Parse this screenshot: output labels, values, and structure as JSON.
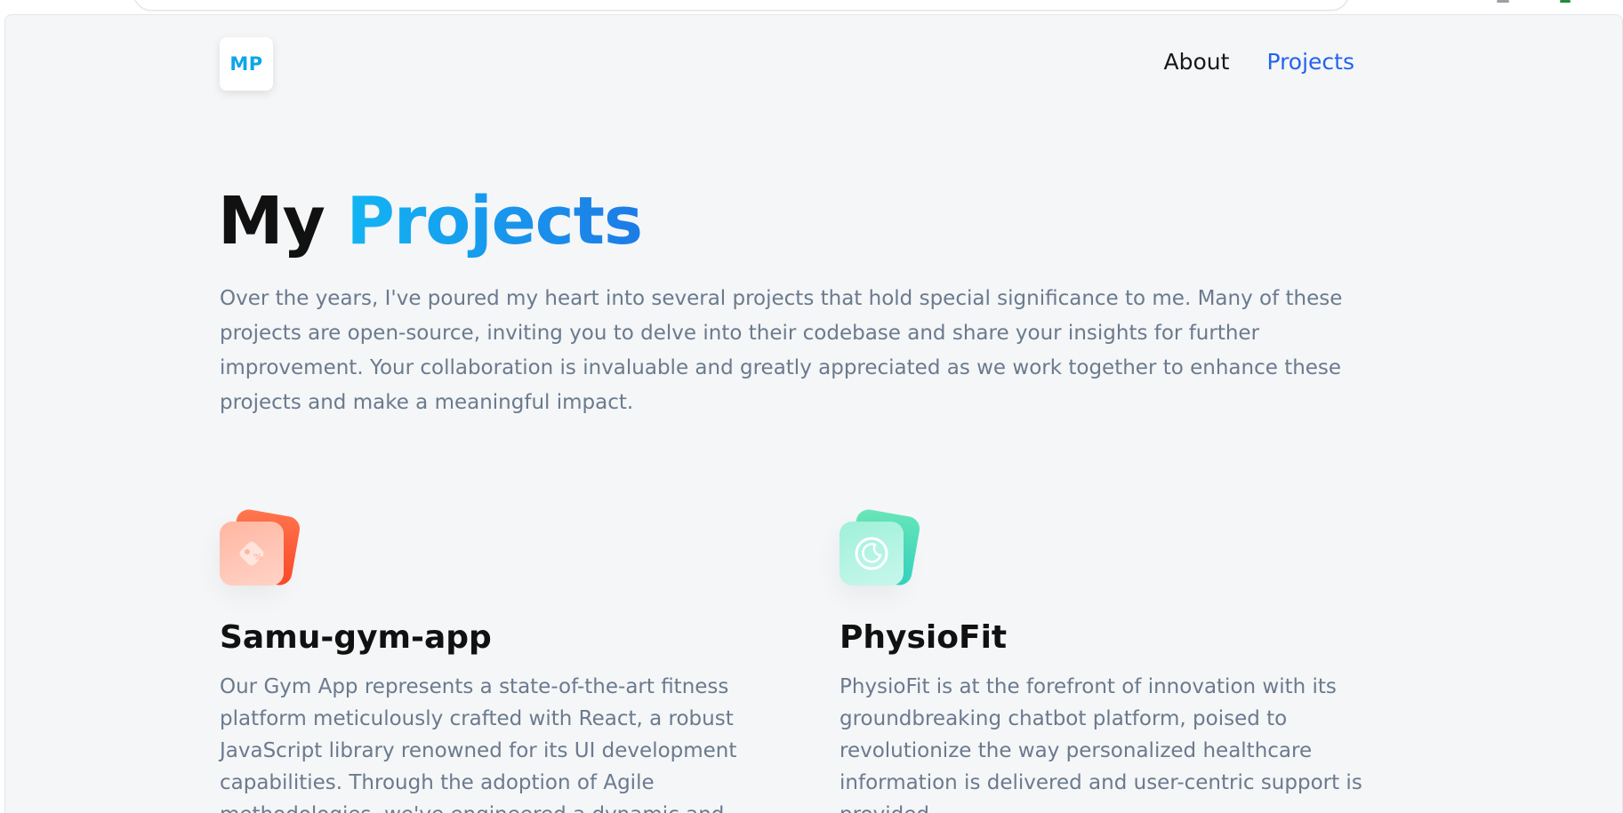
{
  "nav": {
    "logo_text": "MP",
    "links": [
      {
        "label": "About",
        "active": false
      },
      {
        "label": "Projects",
        "active": true
      }
    ],
    "active_color": "#2563eb"
  },
  "hero": {
    "title_plain": "My",
    "title_accent": "Projects",
    "description": "Over the years, I've poured my heart into several projects that hold special significance to me. Many of these projects are open-source, inviting you to delve into their codebase and share your insights for further improvement. Your collaboration is invaluable and greatly appreciated as we work together to enhance these projects and make a meaningful impact."
  },
  "projects": [
    {
      "icon": "tag-icon",
      "title": "Samu-gym-app",
      "description": "Our Gym App represents a state-of-the-art fitness platform meticulously crafted with React, a robust JavaScript library renowned for its UI development capabilities. Through the adoption of Agile methodologies, we've engineered a dynamic and"
    },
    {
      "icon": "moon-clock-icon",
      "title": "PhysioFit",
      "description": "PhysioFit is at the forefront of innovation with its groundbreaking chatbot platform, poised to revolutionize the way personalized healthcare information is delivered and user-centric support is provided."
    }
  ]
}
